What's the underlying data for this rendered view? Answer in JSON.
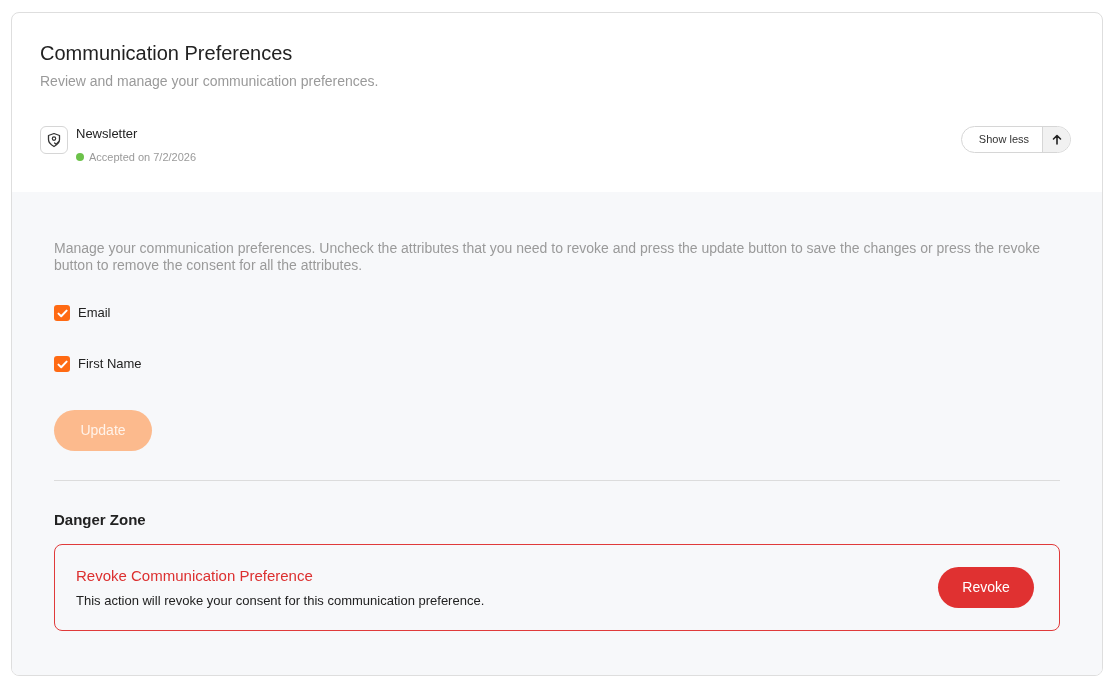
{
  "header": {
    "title": "Communication Preferences",
    "subtitle": "Review and manage your communication preferences."
  },
  "preference": {
    "name": "Newsletter",
    "status": {
      "text": "Accepted on 7/2/2026",
      "color": "#6cc24a"
    },
    "toggle": {
      "label": "Show less",
      "expanded": true
    }
  },
  "details": {
    "description": "Manage your communication preferences. Uncheck the attributes that you need to revoke and press the update button to save the changes or press the revoke button to remove the consent for all the attributes.",
    "attributes": [
      {
        "label": "Email",
        "checked": true
      },
      {
        "label": "First Name",
        "checked": true
      }
    ],
    "update_button": {
      "label": "Update",
      "disabled": true
    }
  },
  "danger_zone": {
    "heading": "Danger Zone",
    "title": "Revoke Communication Preference",
    "description": "This action will revoke your consent for this communication preference.",
    "button": "Revoke"
  }
}
